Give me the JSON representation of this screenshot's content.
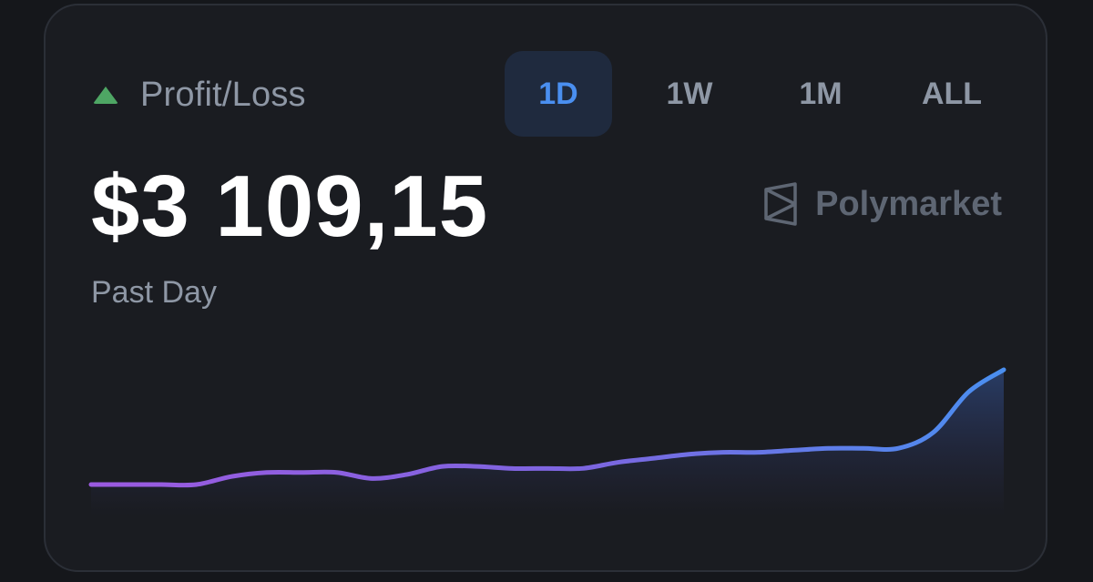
{
  "header": {
    "indicator_icon": "triangle-up-icon",
    "indicator_color": "#4ea664",
    "label": "Profit/Loss"
  },
  "tabs": [
    {
      "label": "1D",
      "active": true
    },
    {
      "label": "1W",
      "active": false
    },
    {
      "label": "1M",
      "active": false
    },
    {
      "label": "ALL",
      "active": false
    }
  ],
  "value": {
    "amount": "$3 109,15",
    "period": "Past Day"
  },
  "brand": {
    "name": "Polymarket",
    "icon": "polymarket-logo-icon"
  },
  "colors": {
    "accent": "#4a8ff0",
    "line_start": "#9b5ae0",
    "line_end": "#4a8ff0"
  },
  "chart_data": {
    "type": "area",
    "x": [
      0,
      1,
      2,
      3,
      4,
      5,
      6,
      7,
      8,
      9,
      10,
      11,
      12,
      13,
      14,
      15,
      16,
      17,
      18,
      19,
      20,
      21,
      22,
      23,
      24,
      25,
      26
    ],
    "values": [
      0,
      0,
      0,
      0,
      4,
      6,
      6,
      6,
      3,
      5,
      9,
      9,
      8,
      8,
      8,
      11,
      13,
      15,
      16,
      16,
      17,
      18,
      18,
      18,
      26,
      46,
      57
    ]
  }
}
